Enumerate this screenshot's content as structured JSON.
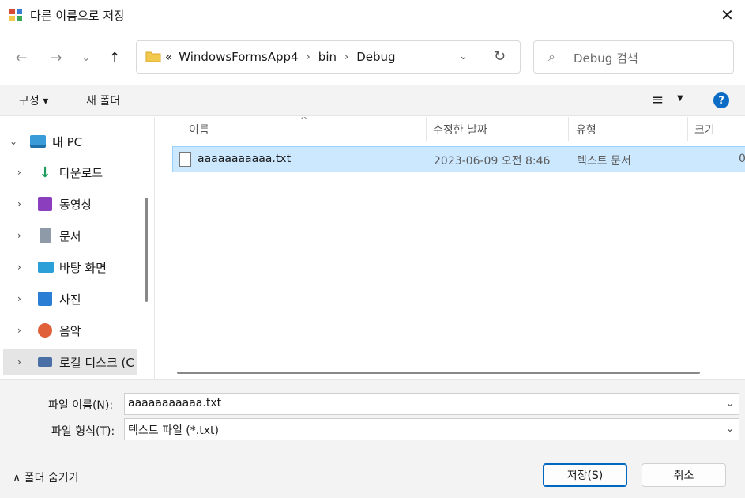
{
  "window": {
    "title": "다른 이름으로 저장",
    "close_glyph": "✕"
  },
  "nav": {
    "back_glyph": "←",
    "forward_glyph": "→",
    "recent_glyph": "⌄",
    "up_glyph": "↑",
    "breadcrumb_prefix": "«",
    "breadcrumbs": [
      "WindowsFormsApp4",
      "bin",
      "Debug"
    ],
    "crumb_sep": "›",
    "dropdown_glyph": "⌄",
    "refresh_glyph": "↻",
    "search_placeholder": "Debug 검색",
    "search_glyph": "⌕"
  },
  "commandbar": {
    "organize_label": "구성 ▾",
    "new_folder_label": "새 폴더",
    "view_glyph": "≡",
    "view_dropdown_glyph": "▼",
    "help_glyph": "?"
  },
  "sidebar": {
    "items": [
      {
        "label": "내 PC",
        "chev": "⌄",
        "icon": "pc-icon",
        "color": "#3a9bd9"
      },
      {
        "label": "다운로드",
        "chev": "›",
        "icon": "download-icon",
        "color": "#1e9e5a"
      },
      {
        "label": "동영상",
        "chev": "›",
        "icon": "video-icon",
        "color": "#8b3fbf"
      },
      {
        "label": "문서",
        "chev": "›",
        "icon": "document-icon",
        "color": "#6c7a89"
      },
      {
        "label": "바탕 화면",
        "chev": "›",
        "icon": "desktop-icon",
        "color": "#2b9fd8"
      },
      {
        "label": "사진",
        "chev": "›",
        "icon": "pictures-icon",
        "color": "#2a7fd4"
      },
      {
        "label": "음악",
        "chev": "›",
        "icon": "music-icon",
        "color": "#e0603a"
      },
      {
        "label": "로컬 디스크 (C",
        "chev": "›",
        "icon": "disk-icon",
        "color": "#4a6fa5"
      }
    ]
  },
  "filelist": {
    "columns": [
      "이름",
      "수정한 날짜",
      "유형",
      "크기"
    ],
    "sort_glyph": "^",
    "rows": [
      {
        "name": "aaaaaaaaaaa.txt",
        "modified": "2023-06-09 오전 8:46",
        "type": "텍스트 문서",
        "size": "0"
      }
    ]
  },
  "form": {
    "filename_label": "파일 이름(N):",
    "filename_value": "aaaaaaaaaaa.txt",
    "filetype_label": "파일 형식(T):",
    "filetype_value": "텍스트 파일 (*.txt)",
    "dropdown_glyph": "⌄",
    "hide_folders_label": "∧  폴더 숨기기",
    "save_label": "저장(S)",
    "cancel_label": "취소"
  },
  "colors": {
    "accent": "#0067c0",
    "selection": "#cce8ff",
    "folder": "#f2c94c"
  }
}
